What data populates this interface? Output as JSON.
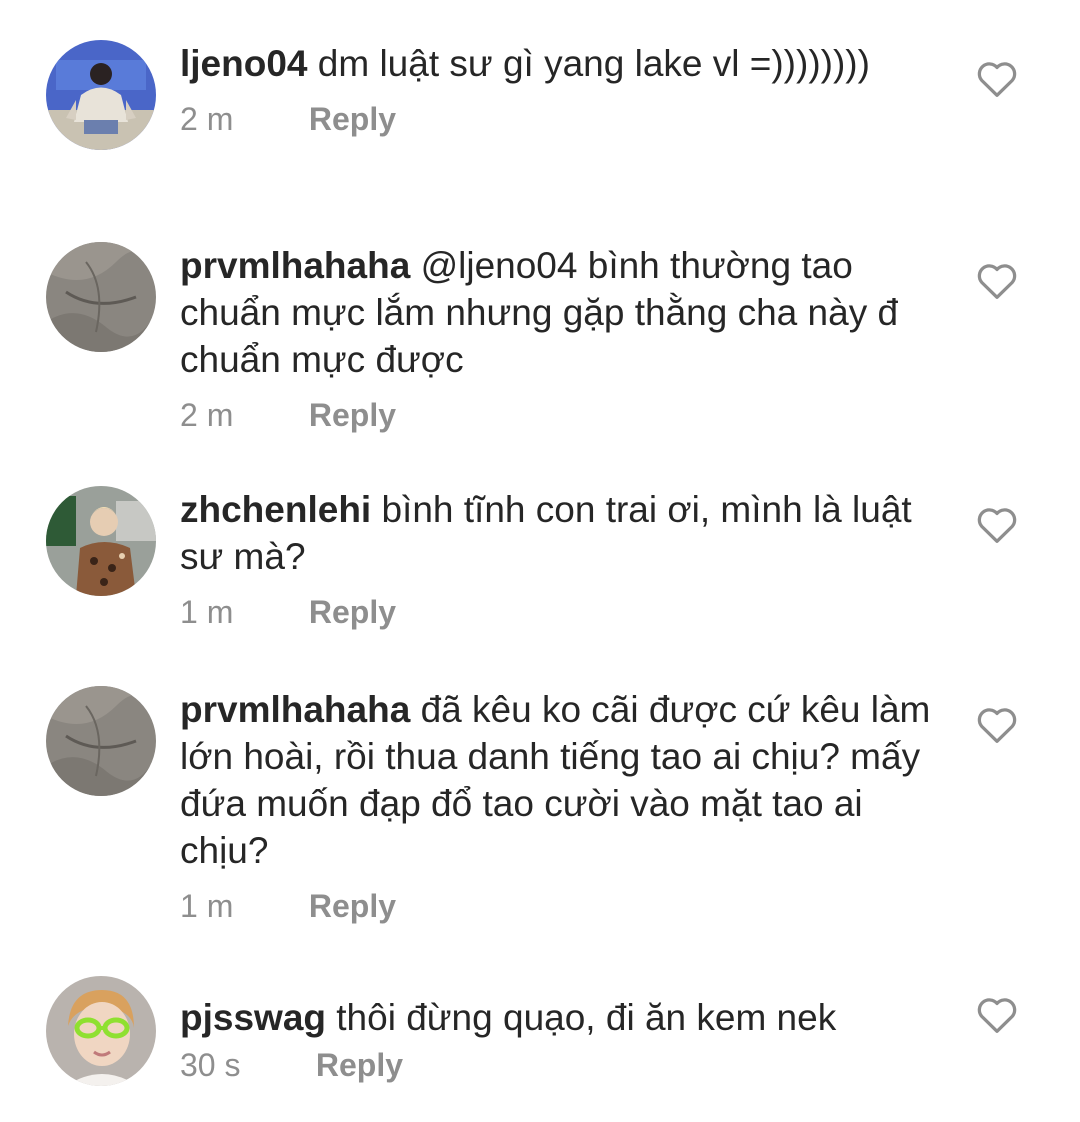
{
  "comments": [
    {
      "username": "ljeno04",
      "text": " dm luật sư gì yang lake vl =))))))))",
      "time": "2 m",
      "reply_label": "Reply",
      "avatar_icon": "avatar-photo-person-crouching",
      "like_icon": "heart-outline-icon"
    },
    {
      "username": "prvmlhahaha",
      "text": " @ljeno04 bình thường tao chuẩn mực lắm nhưng gặp thằng cha này đ chuẩn mực được",
      "time": "2 m",
      "reply_label": "Reply",
      "avatar_icon": "avatar-photo-gray-texture",
      "like_icon": "heart-outline-icon"
    },
    {
      "username": "zhchenlehi",
      "text": " bình tĩnh con trai ơi, mình là luật sư mà?",
      "time": "1 m",
      "reply_label": "Reply",
      "avatar_icon": "avatar-photo-person-patterned-shirt",
      "like_icon": "heart-outline-icon"
    },
    {
      "username": "prvmlhahaha",
      "text": " đã kêu ko cãi được cứ kêu làm lớn hoài, rồi thua danh tiếng tao ai chịu? mấy đứa muốn đạp đổ tao cười vào mặt tao ai chịu?",
      "time": "1 m",
      "reply_label": "Reply",
      "avatar_icon": "avatar-photo-gray-texture",
      "like_icon": "heart-outline-icon"
    },
    {
      "username": "pjsswag",
      "text": " thôi đừng quạo, đi ăn kem nek",
      "time": "30 s",
      "reply_label": "Reply",
      "avatar_icon": "avatar-photo-person-green-glasses",
      "like_icon": "heart-outline-icon"
    }
  ],
  "colors": {
    "text": "#262626",
    "meta": "#8e8e8e",
    "heart_stroke": "#8e8e8e"
  }
}
